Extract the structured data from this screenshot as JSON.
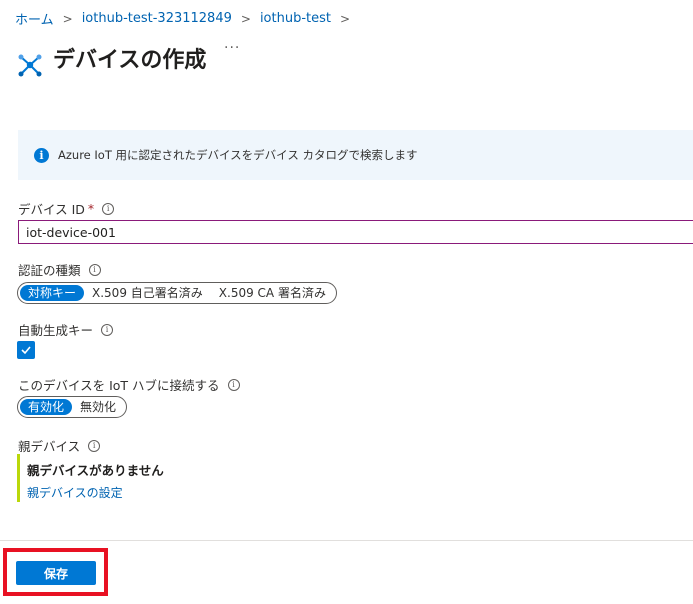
{
  "breadcrumb": [
    "ホーム",
    "iothub-test-323112849",
    "iothub-test"
  ],
  "page": {
    "title": "デバイスの作成",
    "more": "···"
  },
  "info_bar": {
    "icon": "info-icon",
    "text": "Azure IoT 用に認定されたデバイスをデバイス カタログで検索します"
  },
  "device_id": {
    "label": "デバイス ID",
    "required_mark": "*",
    "value": "iot-device-001"
  },
  "auth_type": {
    "label": "認証の種類",
    "options": [
      "対称キー",
      "X.509 自己署名済み",
      "X.509 CA 署名済み"
    ],
    "selected": "対称キー"
  },
  "auto_generate": {
    "label": "自動生成キー",
    "checked": true
  },
  "connect": {
    "label": "このデバイスを IoT ハブに接続する",
    "options": [
      "有効化",
      "無効化"
    ],
    "selected": "有効化"
  },
  "parent": {
    "label": "親デバイス",
    "none_text": "親デバイスがありません",
    "link": "親デバイスの設定"
  },
  "footer": {
    "save_label": "保存"
  },
  "colors": {
    "accent": "#0078d4",
    "info_bg": "#eff6fc",
    "highlight": "#e81123",
    "parent_bar": "#bad80a"
  }
}
